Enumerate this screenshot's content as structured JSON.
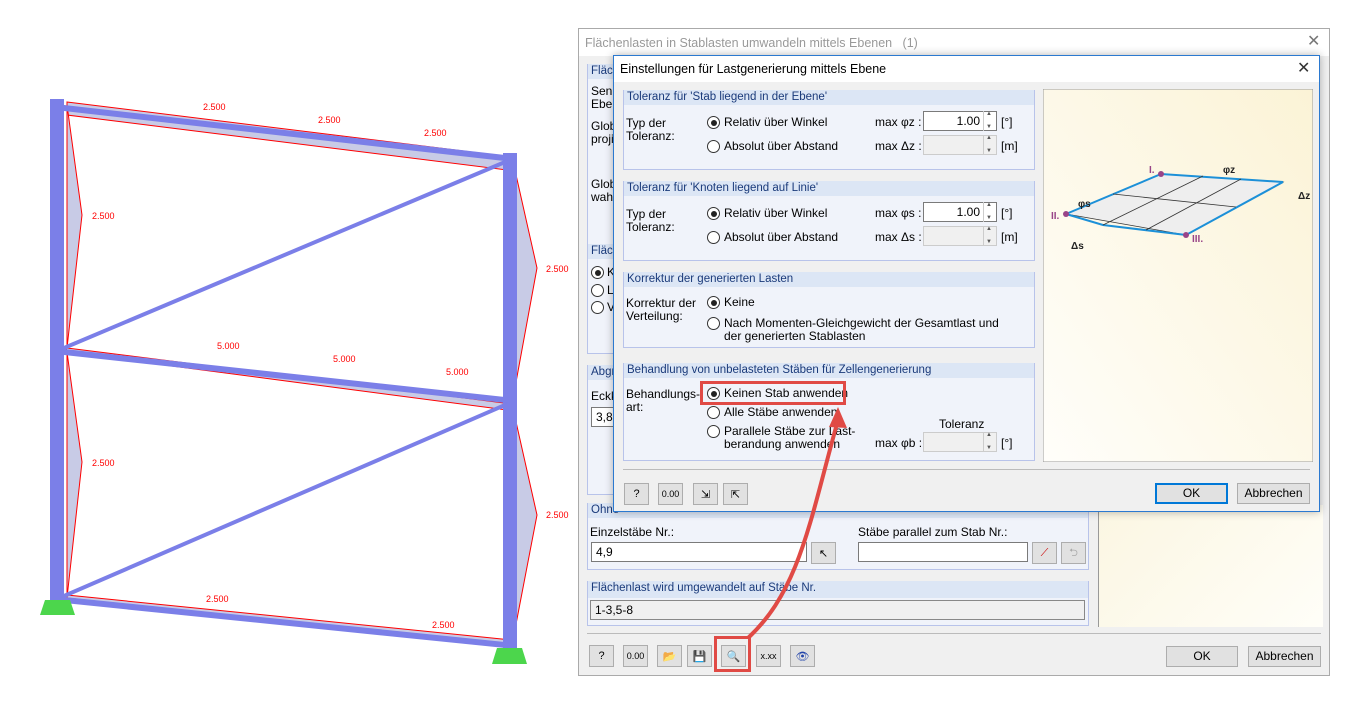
{
  "model": {
    "load_labels": [
      "2.500",
      "2.500",
      "2.500",
      "2.500",
      "2.500",
      "5.000",
      "5.000",
      "5.000",
      "2.500",
      "2.500",
      "2.500",
      "2.500"
    ],
    "colors": {
      "member": "#7b7fe8",
      "load": "#ff0000",
      "load_fill": "#c8cbe6",
      "support": "#4cd64c"
    }
  },
  "bg_dialog": {
    "title": "Flächenlasten in Stablasten umwandeln mittels Ebenen   (1)",
    "clipped_labels": [
      "Fläch",
      "Senk",
      "Eben",
      "Globa",
      "projiz",
      "Globa",
      "wahr",
      "Fläch",
      "Abgr",
      "Eckkr",
      "Ohne"
    ],
    "radio_clipped": [
      "Ko",
      "Li",
      "Vo"
    ],
    "corner_input": "3,8",
    "single_members_label": "Einzelstäbe Nr.:",
    "single_members_value": "4,9",
    "parallel_label": "Stäbe parallel zum Stab Nr.:",
    "parallel_value": "",
    "converted_header": "Flächenlast wird umgewandelt auf Stäbe Nr.",
    "converted_value": "1-3,5-8",
    "ok": "OK",
    "cancel": "Abbrechen",
    "toolbar": [
      "help-icon",
      "units-icon",
      "open-icon",
      "save-icon",
      "settings-search-icon",
      "decimal-icon",
      "view-icon"
    ]
  },
  "dialog": {
    "title": "Einstellungen für Lastgenerierung mittels Ebene",
    "g1": {
      "header": "Toleranz für 'Stab liegend in der Ebene'",
      "label1": "Typ der",
      "label2": "Toleranz:",
      "opt1": "Relativ über Winkel",
      "opt2": "Absolut über Abstand",
      "f1_label": "max φz :",
      "f1_value": "1.00",
      "f1_unit": "[°]",
      "f2_label": "max Δz :",
      "f2_value": "",
      "f2_unit": "[m]"
    },
    "g2": {
      "header": "Toleranz für 'Knoten liegend auf Linie'",
      "label1": "Typ der",
      "label2": "Toleranz:",
      "opt1": "Relativ über Winkel",
      "opt2": "Absolut über Abstand",
      "f1_label": "max φs :",
      "f1_value": "1.00",
      "f1_unit": "[°]",
      "f2_label": "max Δs :",
      "f2_value": "",
      "f2_unit": "[m]"
    },
    "g3": {
      "header": "Korrektur der generierten Lasten",
      "label1": "Korrektur der",
      "label2": "Verteilung:",
      "opt1": "Keine",
      "opt2a": "Nach Momenten-Gleichgewicht der Gesamtlast und",
      "opt2b": "der generierten Stablasten"
    },
    "g4": {
      "header": "Behandlung von unbelasteten Stäben für Zellengenerierung",
      "label1": "Behandlungs-",
      "label2": "art:",
      "opt1": "Keinen Stab anwenden",
      "opt2": "Alle Stäbe anwenden",
      "opt3a": "Parallele Stäbe zur Last-",
      "opt3b": "berandung anwenden",
      "tol_header": "Toleranz",
      "f_label": "max φb :",
      "f_value": "",
      "f_unit": "[°]"
    },
    "figure_labels": [
      "I.",
      "II.",
      "III.",
      "φz",
      "Δz",
      "φs",
      "Δs"
    ],
    "ok": "OK",
    "cancel": "Abbrechen",
    "toolbar": [
      "help-icon",
      "units-icon",
      "import-icon",
      "export-icon"
    ]
  },
  "highlight_color": "#e04a45"
}
